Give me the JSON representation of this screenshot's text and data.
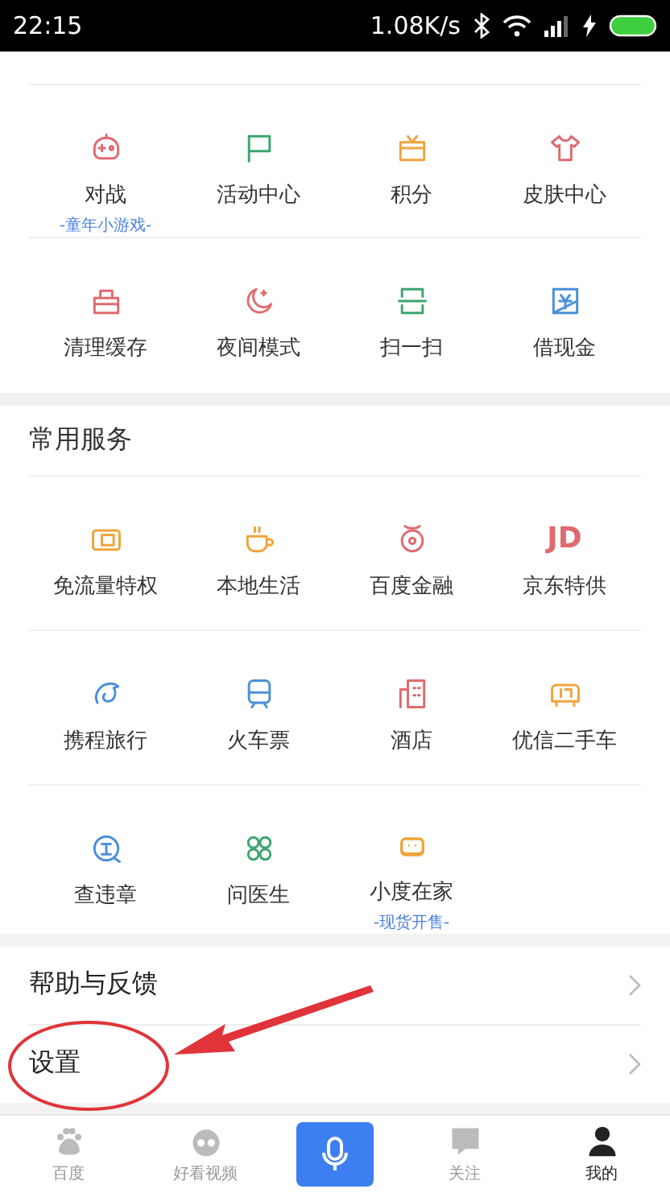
{
  "status_bar": {
    "time": "22:15",
    "speed": "1.08K/s",
    "charging": true
  },
  "top_grid": [
    {
      "label": "对战",
      "sublabel": "-童年小游戏-",
      "color": "#e06a6f"
    },
    {
      "label": "活动中心",
      "color": "#3aa66e"
    },
    {
      "label": "积分",
      "color": "#f0a43a"
    },
    {
      "label": "皮肤中心",
      "color": "#e06a6f"
    },
    {
      "label": "清理缓存",
      "color": "#e06a6f"
    },
    {
      "label": "夜间模式",
      "color": "#e06a6f"
    },
    {
      "label": "扫一扫",
      "color": "#3aa66e"
    },
    {
      "label": "借现金",
      "color": "#4a90d9"
    }
  ],
  "services": {
    "title": "常用服务",
    "items": [
      {
        "label": "免流量特权",
        "color": "#f0a43a"
      },
      {
        "label": "本地生活",
        "color": "#f0a43a"
      },
      {
        "label": "百度金融",
        "color": "#e06a6f"
      },
      {
        "label": "京东特供",
        "color": "#e06a6f",
        "icon_text": "JD"
      },
      {
        "label": "携程旅行",
        "color": "#4a90d9"
      },
      {
        "label": "火车票",
        "color": "#4a90d9"
      },
      {
        "label": "酒店",
        "color": "#e06a6f"
      },
      {
        "label": "优信二手车",
        "color": "#f0a43a"
      },
      {
        "label": "查违章",
        "color": "#4a90d9"
      },
      {
        "label": "问医生",
        "color": "#3aa66e"
      },
      {
        "label": "小度在家",
        "sublabel": "-现货开售-",
        "color": "#f0a43a"
      }
    ]
  },
  "menu": [
    {
      "label": "帮助与反馈"
    },
    {
      "label": "设置"
    }
  ],
  "annotation": {
    "color": "#e0343a"
  },
  "bottom_nav": [
    {
      "kind": "tab",
      "label": "百度",
      "selected": false
    },
    {
      "kind": "tab",
      "label": "好看视频",
      "selected": false
    },
    {
      "kind": "voice"
    },
    {
      "kind": "tab",
      "label": "关注",
      "selected": false
    },
    {
      "kind": "tab",
      "label": "我的",
      "selected": true
    }
  ]
}
